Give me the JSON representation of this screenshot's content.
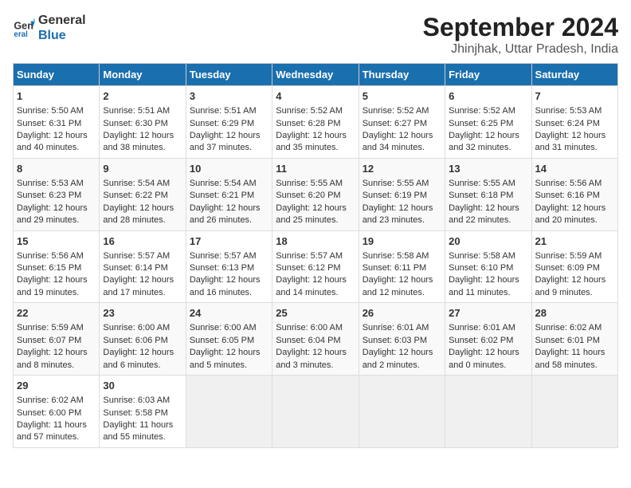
{
  "logo": {
    "line1": "General",
    "line2": "Blue"
  },
  "title": "September 2024",
  "subtitle": "Jhinjhak, Uttar Pradesh, India",
  "days_of_week": [
    "Sunday",
    "Monday",
    "Tuesday",
    "Wednesday",
    "Thursday",
    "Friday",
    "Saturday"
  ],
  "weeks": [
    [
      {
        "day": "1",
        "info": "Sunrise: 5:50 AM\nSunset: 6:31 PM\nDaylight: 12 hours\nand 40 minutes."
      },
      {
        "day": "2",
        "info": "Sunrise: 5:51 AM\nSunset: 6:30 PM\nDaylight: 12 hours\nand 38 minutes."
      },
      {
        "day": "3",
        "info": "Sunrise: 5:51 AM\nSunset: 6:29 PM\nDaylight: 12 hours\nand 37 minutes."
      },
      {
        "day": "4",
        "info": "Sunrise: 5:52 AM\nSunset: 6:28 PM\nDaylight: 12 hours\nand 35 minutes."
      },
      {
        "day": "5",
        "info": "Sunrise: 5:52 AM\nSunset: 6:27 PM\nDaylight: 12 hours\nand 34 minutes."
      },
      {
        "day": "6",
        "info": "Sunrise: 5:52 AM\nSunset: 6:25 PM\nDaylight: 12 hours\nand 32 minutes."
      },
      {
        "day": "7",
        "info": "Sunrise: 5:53 AM\nSunset: 6:24 PM\nDaylight: 12 hours\nand 31 minutes."
      }
    ],
    [
      {
        "day": "8",
        "info": "Sunrise: 5:53 AM\nSunset: 6:23 PM\nDaylight: 12 hours\nand 29 minutes."
      },
      {
        "day": "9",
        "info": "Sunrise: 5:54 AM\nSunset: 6:22 PM\nDaylight: 12 hours\nand 28 minutes."
      },
      {
        "day": "10",
        "info": "Sunrise: 5:54 AM\nSunset: 6:21 PM\nDaylight: 12 hours\nand 26 minutes."
      },
      {
        "day": "11",
        "info": "Sunrise: 5:55 AM\nSunset: 6:20 PM\nDaylight: 12 hours\nand 25 minutes."
      },
      {
        "day": "12",
        "info": "Sunrise: 5:55 AM\nSunset: 6:19 PM\nDaylight: 12 hours\nand 23 minutes."
      },
      {
        "day": "13",
        "info": "Sunrise: 5:55 AM\nSunset: 6:18 PM\nDaylight: 12 hours\nand 22 minutes."
      },
      {
        "day": "14",
        "info": "Sunrise: 5:56 AM\nSunset: 6:16 PM\nDaylight: 12 hours\nand 20 minutes."
      }
    ],
    [
      {
        "day": "15",
        "info": "Sunrise: 5:56 AM\nSunset: 6:15 PM\nDaylight: 12 hours\nand 19 minutes."
      },
      {
        "day": "16",
        "info": "Sunrise: 5:57 AM\nSunset: 6:14 PM\nDaylight: 12 hours\nand 17 minutes."
      },
      {
        "day": "17",
        "info": "Sunrise: 5:57 AM\nSunset: 6:13 PM\nDaylight: 12 hours\nand 16 minutes."
      },
      {
        "day": "18",
        "info": "Sunrise: 5:57 AM\nSunset: 6:12 PM\nDaylight: 12 hours\nand 14 minutes."
      },
      {
        "day": "19",
        "info": "Sunrise: 5:58 AM\nSunset: 6:11 PM\nDaylight: 12 hours\nand 12 minutes."
      },
      {
        "day": "20",
        "info": "Sunrise: 5:58 AM\nSunset: 6:10 PM\nDaylight: 12 hours\nand 11 minutes."
      },
      {
        "day": "21",
        "info": "Sunrise: 5:59 AM\nSunset: 6:09 PM\nDaylight: 12 hours\nand 9 minutes."
      }
    ],
    [
      {
        "day": "22",
        "info": "Sunrise: 5:59 AM\nSunset: 6:07 PM\nDaylight: 12 hours\nand 8 minutes."
      },
      {
        "day": "23",
        "info": "Sunrise: 6:00 AM\nSunset: 6:06 PM\nDaylight: 12 hours\nand 6 minutes."
      },
      {
        "day": "24",
        "info": "Sunrise: 6:00 AM\nSunset: 6:05 PM\nDaylight: 12 hours\nand 5 minutes."
      },
      {
        "day": "25",
        "info": "Sunrise: 6:00 AM\nSunset: 6:04 PM\nDaylight: 12 hours\nand 3 minutes."
      },
      {
        "day": "26",
        "info": "Sunrise: 6:01 AM\nSunset: 6:03 PM\nDaylight: 12 hours\nand 2 minutes."
      },
      {
        "day": "27",
        "info": "Sunrise: 6:01 AM\nSunset: 6:02 PM\nDaylight: 12 hours\nand 0 minutes."
      },
      {
        "day": "28",
        "info": "Sunrise: 6:02 AM\nSunset: 6:01 PM\nDaylight: 11 hours\nand 58 minutes."
      }
    ],
    [
      {
        "day": "29",
        "info": "Sunrise: 6:02 AM\nSunset: 6:00 PM\nDaylight: 11 hours\nand 57 minutes."
      },
      {
        "day": "30",
        "info": "Sunrise: 6:03 AM\nSunset: 5:58 PM\nDaylight: 11 hours\nand 55 minutes."
      },
      {
        "day": "",
        "info": ""
      },
      {
        "day": "",
        "info": ""
      },
      {
        "day": "",
        "info": ""
      },
      {
        "day": "",
        "info": ""
      },
      {
        "day": "",
        "info": ""
      }
    ]
  ]
}
